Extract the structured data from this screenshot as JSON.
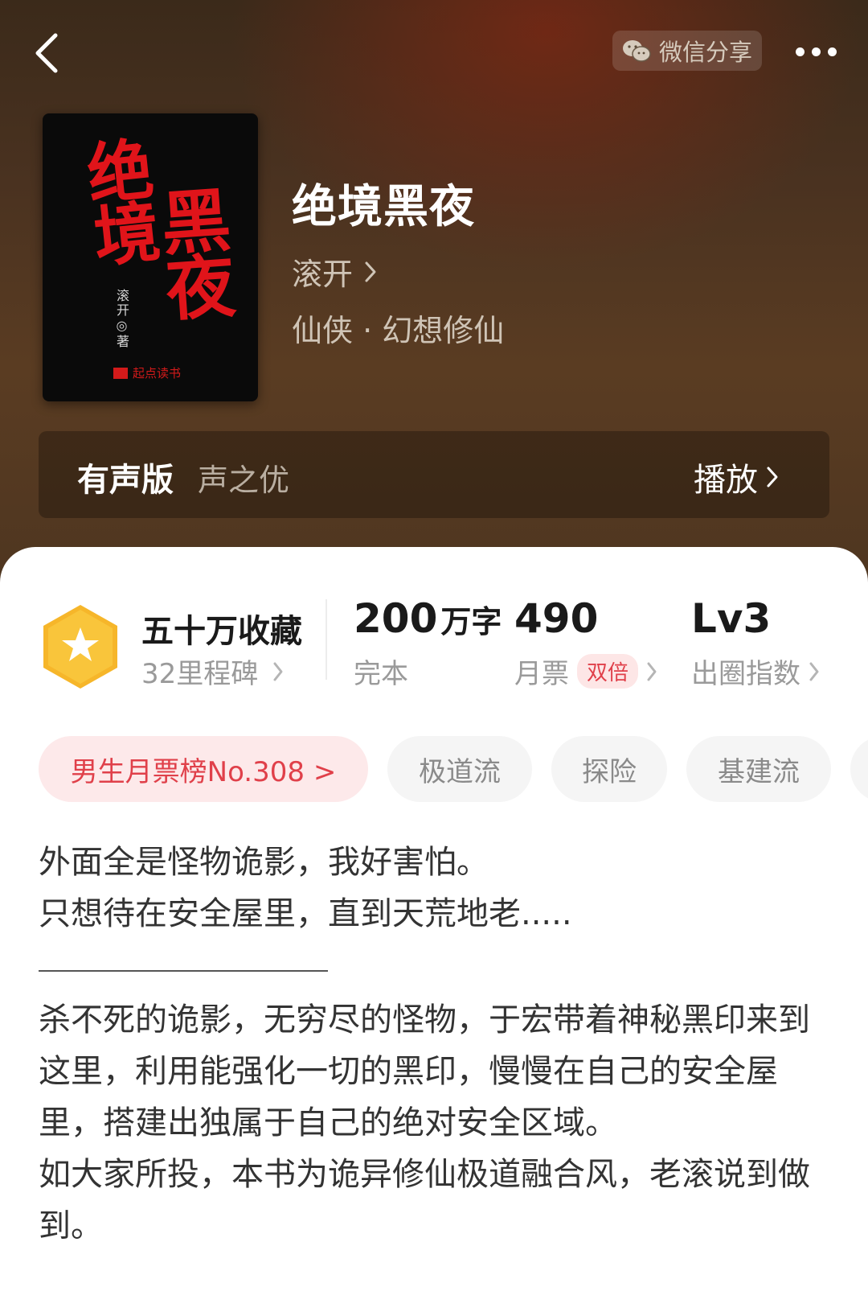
{
  "header": {
    "share_label": "微信分享"
  },
  "book": {
    "cover": {
      "title_line1": "绝境",
      "title_line2": "黑夜",
      "author": "滚开◎著",
      "brand": "起点读书"
    },
    "title": "绝境黑夜",
    "author": "滚开",
    "genre": "仙侠 · 幻想修仙"
  },
  "audio": {
    "label": "有声版",
    "narrator": "声之优",
    "play_label": "播放"
  },
  "stats": {
    "collect_label": "五十万收藏",
    "milestone_label": "32里程碑",
    "words_value": "200",
    "words_unit": "万字",
    "status_label": "完本",
    "tickets_value": "490",
    "tickets_label": "月票",
    "double_badge": "双倍",
    "level_value": "Lv3",
    "level_label": "出圈指数"
  },
  "tags": [
    "男生月票榜No.308 >",
    "极道流",
    "探险",
    "基建流"
  ],
  "synopsis": {
    "intro_lines": [
      "外面全是怪物诡影，我好害怕。",
      "只想待在安全屋里，直到天荒地老....."
    ],
    "body": "杀不死的诡影，无穷尽的怪物，于宏带着神秘黑印来到这里，利用能强化一切的黑印，慢慢在自己的安全屋里，搭建出独属于自己的绝对安全区域。",
    "closing": "如大家所投，本书为诡异修仙极道融合风，老滚说到做到。"
  },
  "colors": {
    "accent_red": "#e0404a",
    "badge_orange": "#f6b62a",
    "hero_brown": "#4a3220"
  },
  "icons": [
    "back-arrow-icon",
    "wechat-icon",
    "more-dots-icon",
    "chevron-right-icon",
    "star-hexagon-icon"
  ]
}
